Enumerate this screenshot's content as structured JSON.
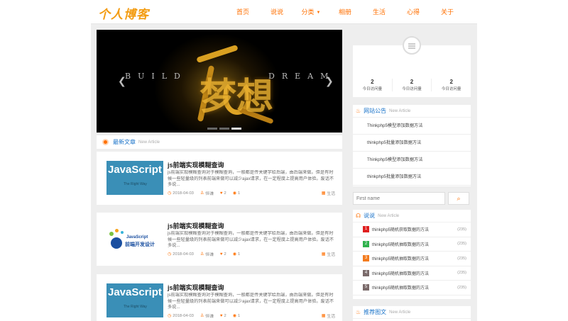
{
  "logo": "个人博客",
  "nav": [
    {
      "label": "首页"
    },
    {
      "label": "说说"
    },
    {
      "label": "分类",
      "dropdown": true
    },
    {
      "label": "相册"
    },
    {
      "label": "生活"
    },
    {
      "label": "心得"
    },
    {
      "label": "关于"
    }
  ],
  "banner": {
    "big_text": "梦想",
    "sub_left": "BUILD",
    "sub_right": "DREAM",
    "slides": 3,
    "active_slide": 3
  },
  "latest": {
    "title": "最新文章",
    "subtitle": "New Article"
  },
  "articles": [
    {
      "thumb": "javascript",
      "thumb_text": "JavaScript",
      "thumb_sub": "The Right Way",
      "title": "js前端实现模糊查询",
      "desc": "js前端实现模糊查询对于模糊查询，一般都是传关键字给后端，由后端来做。但是有时候一些轻量级的列表前端来做可以减少ajax请求，在一定程度上提高用户体验。废话不多说...",
      "date": "2018-04-03",
      "author": "恒谦",
      "likes": "2",
      "views": "1",
      "tag": "生活"
    },
    {
      "thumb": "logo",
      "thumb_text": "JavaScript",
      "thumb_sub": "前端开发设计",
      "title": "js前端实现模糊查询",
      "desc": "js前端实现模糊查询对于模糊查询，一般都是传关键字给后端，由后端来做。但是有时候一些轻量级的列表前端来做可以减少ajax请求，在一定程度上提高用户体验。废话不多说...",
      "date": "2018-04-03",
      "author": "恒谦",
      "likes": "2",
      "views": "1",
      "tag": "生活"
    },
    {
      "thumb": "javascript",
      "thumb_text": "JavaScript",
      "thumb_sub": "The Right Way",
      "title": "js前端实现模糊查询",
      "desc": "js前端实现模糊查询对于模糊查询，一般都是传关键字给后端，由后端来做。但是有时候一些轻量级的列表前端来做可以减少ajax请求，在一定程度上提高用户体验。废话不多说...",
      "date": "2018-04-03",
      "author": "恒谦",
      "likes": "2",
      "views": "1",
      "tag": "生活"
    }
  ],
  "profile": {
    "stats": [
      {
        "n": "2",
        "l": "今日访问量"
      },
      {
        "n": "2",
        "l": "今日访问量"
      },
      {
        "n": "2",
        "l": "今日访问量"
      }
    ]
  },
  "notice": {
    "title": "网站公告",
    "subtitle": "New Article",
    "items": [
      "Thinkphp5模型添加数据方法",
      "thinkphp5批量添加数据方法",
      "Thinkphp5模型添加数据方法",
      "thinkphp5批量添加数据方法"
    ]
  },
  "search": {
    "placeholder": "First name",
    "button": "⌕"
  },
  "hot": {
    "title": "说说",
    "subtitle": "New Article",
    "items": [
      {
        "num": "1",
        "color": "#e02020",
        "label": "thinkphp5随机获取数据的方法",
        "count": "(235)"
      },
      {
        "num": "2",
        "color": "#2fb24d",
        "label": "thinkphp5随机抽取数据的方法",
        "count": "(235)"
      },
      {
        "num": "3",
        "color": "#f37b1d",
        "label": "thinkphp5随机抽取数据的方法",
        "count": "(235)"
      },
      {
        "num": "4",
        "color": "#7a6a6a",
        "label": "thinkphp5随机抽取数据的方法",
        "count": "(235)"
      },
      {
        "num": "5",
        "color": "#7a6a6a",
        "label": "thinkphp5随机抽取数据的方法",
        "count": "(235)"
      }
    ]
  },
  "recommend": {
    "title": "推荐图文",
    "subtitle": "New Article"
  },
  "colors": {
    "accent": "#ff6f00",
    "link": "#1a73c9",
    "background": "#eeeeee"
  }
}
